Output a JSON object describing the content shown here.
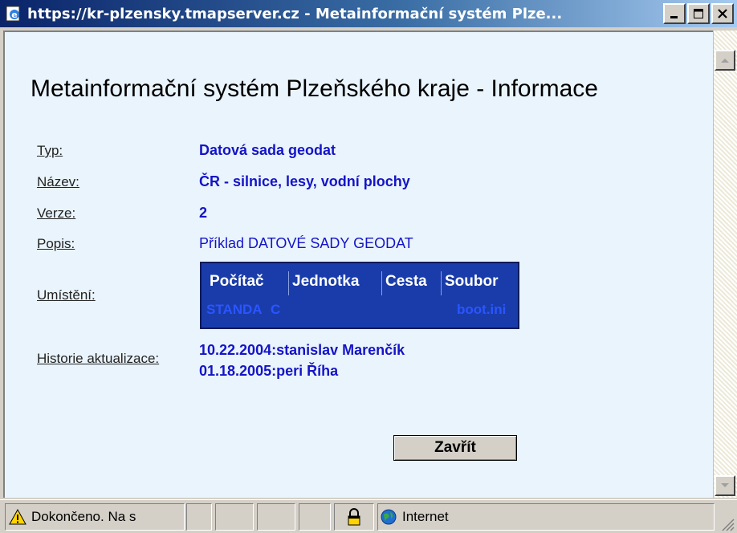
{
  "window": {
    "title": "https://kr-plzensky.tmapserver.cz - Metainformační systém Plze...",
    "controls": [
      "minimize",
      "maximize",
      "close"
    ]
  },
  "page": {
    "heading": "Metainformační systém Plzeňského kraje - Informace",
    "fields": {
      "typ_label": "Typ:",
      "typ_value": "Datová sada geodat",
      "nazev_label": "Název:",
      "nazev_value": "ČR - silnice, lesy, vodní plochy",
      "verze_label": "Verze:",
      "verze_value": "2",
      "popis_label": "Popis:",
      "popis_value": "Příklad DATOVÉ SADY GEODAT",
      "umisteni_label": "Umístění:",
      "historie_label": "Historie aktualizace:"
    },
    "location_table": {
      "headers": [
        "Počítač",
        "Jednotka",
        "Cesta",
        "Soubor"
      ],
      "row": [
        "STANDA",
        "C",
        "",
        "boot.ini"
      ]
    },
    "history": [
      "10.22.2004:stanislav Marenčík",
      "01.18.2005:peri Říha"
    ],
    "close_button": "Zavřít"
  },
  "statusbar": {
    "status_text": "Dokončeno. Na s",
    "zone_text": "Internet"
  },
  "colors": {
    "title_gradient_start": "#0a246a",
    "value_text": "#1414c8",
    "table_bg": "#1a3caa",
    "page_bg": "#eaf4fc"
  },
  "icons": {
    "title": "ie-page-icon",
    "status": "warning-icon",
    "lock": "lock-icon",
    "zone": "globe-icon"
  }
}
